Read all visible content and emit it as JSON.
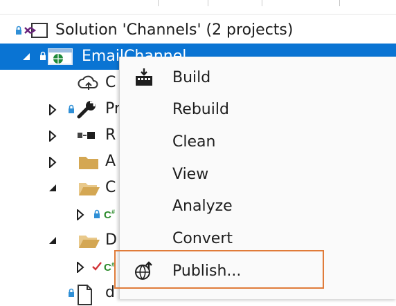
{
  "solution_explorer": {
    "solution_label": "Solution 'Channels' (2 projects)",
    "project_label": "EmailChannel",
    "child_labels": {
      "connected_services": "C",
      "properties": "Pr",
      "references": "R",
      "folder_a": "A",
      "folder_c": "C",
      "file_c": "C",
      "folder_d": "D",
      "file_c2": "C",
      "file_d": "d"
    }
  },
  "context_menu": {
    "items": [
      {
        "label": "Build",
        "icon": "build-icon"
      },
      {
        "label": "Rebuild",
        "icon": ""
      },
      {
        "label": "Clean",
        "icon": ""
      },
      {
        "label": "View",
        "icon": ""
      },
      {
        "label": "Analyze",
        "icon": ""
      },
      {
        "label": "Convert",
        "icon": ""
      },
      {
        "label": "Publish...",
        "icon": "publish-icon"
      }
    ],
    "highlight_color": "#e07b39"
  },
  "colors": {
    "selection": "#0a74d3",
    "lock": "#2f8fd6",
    "csharp": "#2a8a2a",
    "checkmark": "#d13438"
  }
}
